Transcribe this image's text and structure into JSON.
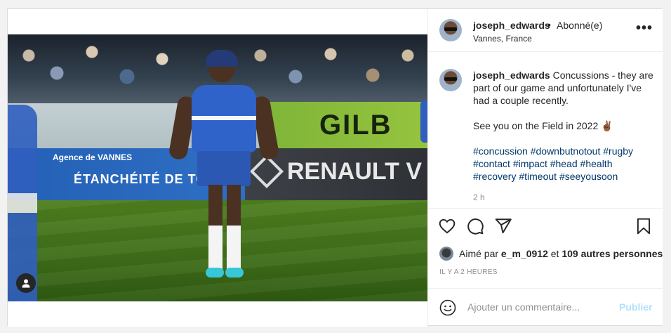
{
  "post": {
    "author": "joseph_edwards",
    "separator": "•",
    "follow_status": "Abonné(e)",
    "location": "Vannes, France",
    "more_label": "•••"
  },
  "photo": {
    "ad_green_text": "GILB",
    "ad_blue_line1": "Agence de VANNES",
    "ad_blue_line2": "ÉTANCHÉITÉ DE TOI",
    "ad_dark_text": "RENAULT V"
  },
  "caption": {
    "author": "joseph_edwards",
    "line1": "Concussions - they are part of our game and unfortunately I've had a couple recently.",
    "line2": "See you on the Field in 2022 ✌🏾",
    "hashtags": "#concussion #downbutnotout #rugby #contact #impact #head #health #recovery #timeout #seeyousoon",
    "time_ago": "2 h"
  },
  "likes": {
    "prefix": "Aimé par ",
    "user": "e_m_0912",
    "middle": " et ",
    "others": "109 autres personnes"
  },
  "posted_label": "IL Y A 2 HEURES",
  "comment": {
    "placeholder": "Ajouter un commentaire...",
    "publish_label": "Publier"
  },
  "colors": {
    "hashtag": "#00376b",
    "publish_disabled": "#b2dffc",
    "meta_gray": "#8e8e8e",
    "text": "#262626"
  },
  "icons": [
    "heart-icon",
    "comment-icon",
    "share-icon",
    "bookmark-icon",
    "emoji-icon",
    "user-tag-icon",
    "more-options-icon"
  ]
}
